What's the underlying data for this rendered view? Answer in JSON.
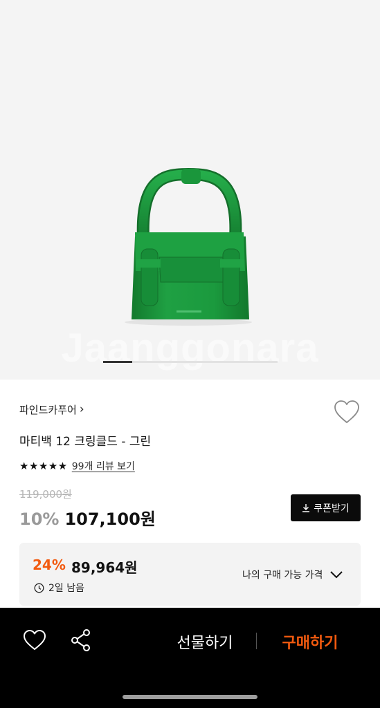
{
  "product": {
    "image_alt": "green mini handbag",
    "watermark": "Jaanggonara",
    "carousel": {
      "count": 7,
      "active": 1
    },
    "brand": "파인드카푸어",
    "brand_chevron": "›",
    "title": "마티백 12 크링클드 - 그린",
    "stars": "★★★★★",
    "review_link": "99개 리뷰 보기",
    "original_price": "119,000원",
    "discount": "10%",
    "price": "107,100원",
    "coupon_button": "쿠폰받기"
  },
  "my_price": {
    "discount": "24%",
    "price": "89,964원",
    "time_left": "2일 남음",
    "label": "나의 구매 가능 가격"
  },
  "bottom_bar": {
    "gift": "선물하기",
    "buy": "구매하기"
  },
  "colors": {
    "accent": "#f25a0f",
    "bag_green": "#1c9a3d",
    "dark": "#0b0b0b"
  }
}
